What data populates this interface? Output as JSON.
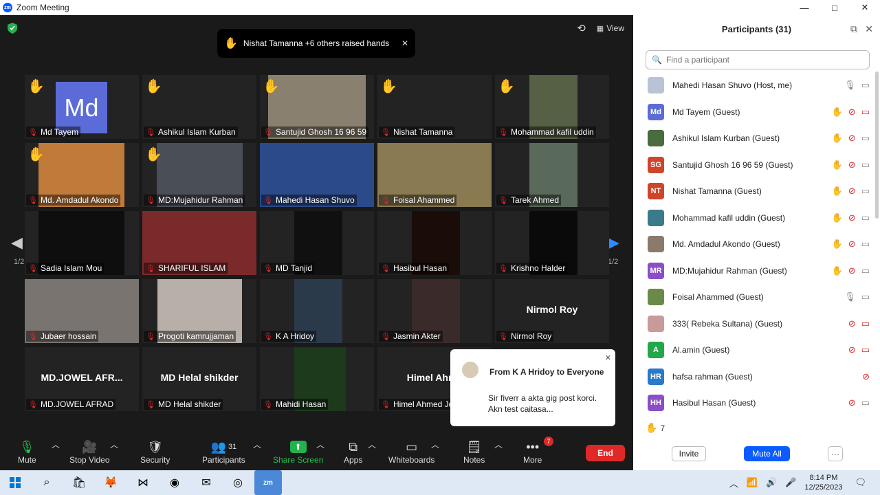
{
  "window": {
    "title": "Zoom Meeting",
    "app_icon": "zm",
    "minimize": "—",
    "maximize": "□",
    "close": "✕"
  },
  "toast": {
    "text": "Nishat Tamanna +6 others raised hands",
    "close": "✕"
  },
  "view_label": "View",
  "nav": {
    "page_left": "1/2",
    "page_right": "1/2"
  },
  "tiles": [
    {
      "name": "Md Tayem",
      "hand": true,
      "avatar": "Md"
    },
    {
      "name": "Ashikul Islam Kurban",
      "hand": true,
      "video": "#4a6b3e"
    },
    {
      "name": "Santujid Ghosh 16 96 59",
      "hand": true,
      "video": "#8a8070"
    },
    {
      "name": "Nishat Tamanna",
      "hand": true
    },
    {
      "name": "Mohammad kafil uddin",
      "hand": true,
      "video": "#556045"
    },
    {
      "name": "Md. Amdadul Akondo",
      "hand": true,
      "video": "#c07a3a"
    },
    {
      "name": "MD:Mujahidur Rahman",
      "hand": true,
      "video": "#4a4e56"
    },
    {
      "name": "Mahedi Hasan Shuvo",
      "hand": false,
      "video": "#2a4a8a",
      "active": true
    },
    {
      "name": "Foisal Ahammed",
      "hand": false,
      "video": "#8a7a52"
    },
    {
      "name": "Tarek Ahmed",
      "hand": false,
      "video": "#5a6a5a"
    },
    {
      "name": "Sadia Islam Mou",
      "hand": false,
      "video": "#0e0e0e"
    },
    {
      "name": "SHARIFUL ISLAM",
      "hand": false,
      "video": "#7a2a2a"
    },
    {
      "name": "MD Tanjid",
      "hand": false,
      "video": "#101010"
    },
    {
      "name": "Hasibul Hasan",
      "hand": false,
      "video": "#1a0c08"
    },
    {
      "name": "Krishno Halder",
      "hand": false,
      "video": "#0a0a0a"
    },
    {
      "name": "Jubaer hossain",
      "hand": false,
      "video": "#7a7470"
    },
    {
      "name": "Progoti kamrujjaman",
      "hand": false,
      "video": "#b8b0a8"
    },
    {
      "name": "K A Hridoy",
      "hand": false,
      "video": "#2a3a4a"
    },
    {
      "name": "Jasmin Akter",
      "hand": false,
      "video": "#3a2a2a"
    },
    {
      "name": "Nirmol Roy",
      "hand": false,
      "big": "Nirmol Roy"
    },
    {
      "name": "MD.JOWEL AFRAD",
      "hand": false,
      "big": "MD.JOWEL  AFR..."
    },
    {
      "name": "MD Helal shikder",
      "hand": false,
      "big": "MD Helal shikder"
    },
    {
      "name": "Mahidi Hasan",
      "hand": false,
      "video": "#1d3a1d"
    },
    {
      "name": "Himel Ahmed Jo",
      "hand": false,
      "big": "Himel Ahme"
    }
  ],
  "chat": {
    "from": "From K A Hridoy to Everyone",
    "message": "Sir fiverr a akta gig post korci. Akn test caitasa...",
    "close": "✕"
  },
  "toolbar": {
    "mute": "Mute",
    "stop_video": "Stop Video",
    "security": "Security",
    "participants": "Participants",
    "participants_count": "31",
    "share_screen": "Share Screen",
    "apps": "Apps",
    "whiteboards": "Whiteboards",
    "notes": "Notes",
    "more": "More",
    "more_badge": "7",
    "end": "End"
  },
  "panel": {
    "title": "Participants (31)",
    "search_placeholder": "Find a participant",
    "raised_count": "7",
    "invite": "Invite",
    "mute_all": "Mute All",
    "more": "···",
    "participants": [
      {
        "name": "Mahedi Hasan Shuvo (Host, me)",
        "initials": "",
        "color": "#b8c4d4",
        "hand": false,
        "mic": "on",
        "cam": "on"
      },
      {
        "name": "Md Tayem (Guest)",
        "initials": "Md",
        "color": "#5b6cd8",
        "hand": true,
        "mic": "muted",
        "cam": "off"
      },
      {
        "name": "Ashikul Islam Kurban (Guest)",
        "initials": "",
        "color": "#4a6b3e",
        "hand": true,
        "mic": "muted",
        "cam": "on"
      },
      {
        "name": "Santujid Ghosh 16 96 59 (Guest)",
        "initials": "SG",
        "color": "#d0452a",
        "hand": true,
        "mic": "muted",
        "cam": "on"
      },
      {
        "name": "Nishat Tamanna (Guest)",
        "initials": "NT",
        "color": "#d0452a",
        "hand": true,
        "mic": "muted",
        "cam": "on"
      },
      {
        "name": "Mohammad kafil uddin (Guest)",
        "initials": "",
        "color": "#3a7a8a",
        "hand": true,
        "mic": "muted",
        "cam": "on"
      },
      {
        "name": "Md. Amdadul Akondo (Guest)",
        "initials": "",
        "color": "#8a7a6a",
        "hand": true,
        "mic": "muted",
        "cam": "on"
      },
      {
        "name": "MD:Mujahidur Rahman (Guest)",
        "initials": "MR",
        "color": "#8a4fc8",
        "hand": true,
        "mic": "muted",
        "cam": "on"
      },
      {
        "name": "Foisal Ahammed (Guest)",
        "initials": "",
        "color": "#6a8a4a",
        "hand": false,
        "mic": "on",
        "cam": "on"
      },
      {
        "name": "333( Rebeka Sultana) (Guest)",
        "initials": "",
        "color": "#c89a9a",
        "hand": false,
        "mic": "muted",
        "cam": "off"
      },
      {
        "name": "Al.amin (Guest)",
        "initials": "A",
        "color": "#22a84a",
        "hand": false,
        "mic": "muted",
        "cam": "off"
      },
      {
        "name": "hafsa rahman (Guest)",
        "initials": "HR",
        "color": "#2a7ac8",
        "hand": false,
        "mic": "muted",
        "cam": "none"
      },
      {
        "name": "Hasibul Hasan (Guest)",
        "initials": "HH",
        "color": "#8a4fc8",
        "hand": false,
        "mic": "muted",
        "cam": "on"
      }
    ]
  },
  "taskbar": {
    "time": "8:14 PM",
    "date": "12/25/2023",
    "zoom": "zm"
  },
  "colors": {
    "accent": "#0b5cff",
    "end": "#e02828",
    "hand": "#f6b51e",
    "share": "#22b34c"
  }
}
